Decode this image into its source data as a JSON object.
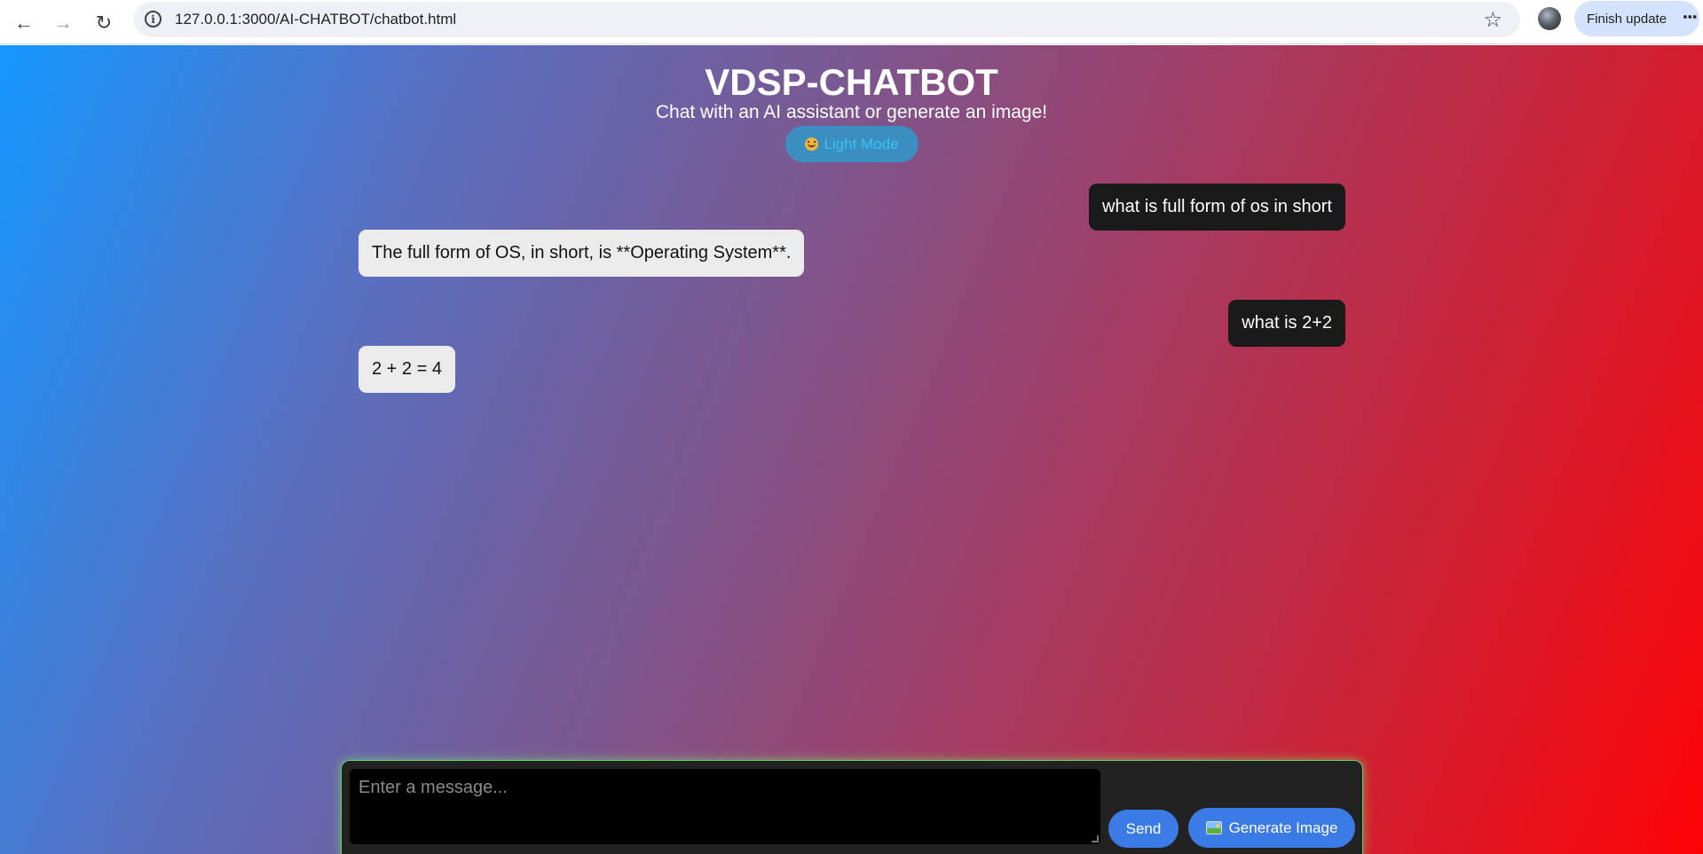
{
  "browser": {
    "url": "127.0.0.1:3000/AI-CHATBOT/chatbot.html",
    "update_label": "Finish update",
    "icons": [
      "back-arrow-icon",
      "forward-arrow-icon",
      "reload-icon",
      "site-info-icon",
      "bookmark-star-icon",
      "profile-avatar",
      "kebab-menu-icon"
    ]
  },
  "header": {
    "title": "VDSP-CHATBOT",
    "subtitle": "Chat with an AI assistant or generate an image!",
    "theme_toggle_label": "Light Mode"
  },
  "messages": [
    {
      "role": "user",
      "text": "what is full form of os in short"
    },
    {
      "role": "bot",
      "text": "The full form of OS, in short, is **Operating System**."
    },
    {
      "role": "user",
      "text": "what is 2+2"
    },
    {
      "role": "bot",
      "text": "2 + 2 = 4"
    }
  ],
  "composer": {
    "placeholder": "Enter a message...",
    "send_label": "Send",
    "generate_label": "Generate Image"
  },
  "colors": {
    "gradient_start": "#1597ff",
    "gradient_end": "#fe0306",
    "user_bubble": "#1a1a1a",
    "bot_bubble": "#ebebeb",
    "button_blue": "#3a7be6"
  }
}
